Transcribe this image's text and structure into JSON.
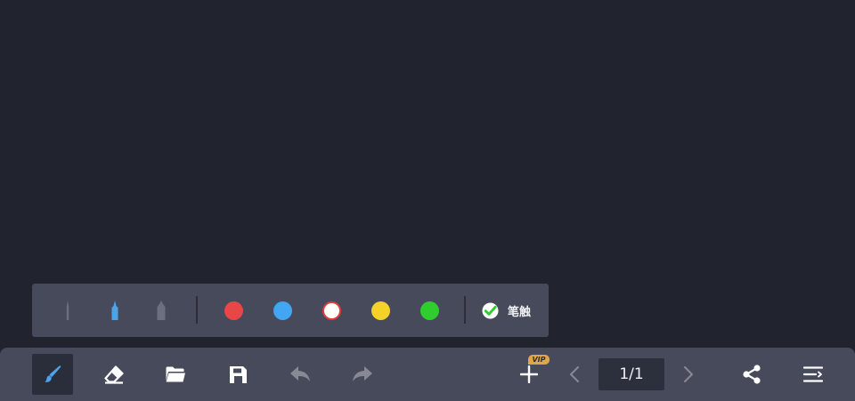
{
  "pen_panel": {
    "pen_sizes": [
      {
        "name": "thin-pen",
        "state": "inactive"
      },
      {
        "name": "medium-pen",
        "state": "selected"
      },
      {
        "name": "thick-pen",
        "state": "inactive"
      }
    ],
    "colors": [
      {
        "name": "red",
        "value": "#e94747",
        "selected": false
      },
      {
        "name": "blue",
        "value": "#43a6f3",
        "selected": false
      },
      {
        "name": "white",
        "value": "#ffffff",
        "selected": true
      },
      {
        "name": "yellow",
        "value": "#f5d22a",
        "selected": false
      },
      {
        "name": "green",
        "value": "#2fce2e",
        "selected": false
      }
    ],
    "texture_label": "笔触",
    "texture_checked": true
  },
  "toolbar": {
    "tools": [
      {
        "name": "brush",
        "icon": "brush-icon",
        "active": true
      },
      {
        "name": "eraser",
        "icon": "eraser-icon",
        "active": false
      },
      {
        "name": "open",
        "icon": "folder-icon",
        "active": false
      },
      {
        "name": "save",
        "icon": "save-icon",
        "active": false
      },
      {
        "name": "undo",
        "icon": "undo-icon",
        "enabled": false
      },
      {
        "name": "redo",
        "icon": "redo-icon",
        "enabled": false
      }
    ],
    "vip_badge": "VIP",
    "page_indicator": "1/1",
    "right_tools": [
      "add-page-icon",
      "prev-page-icon",
      "next-page-icon",
      "share-icon",
      "menu-icon"
    ]
  },
  "colors": {
    "accent": "#4da3e8",
    "background": "#21232f",
    "panel": "#464a5b",
    "icon": "#ffffff",
    "vip": "#e0a748",
    "check": "#2fce2e"
  }
}
